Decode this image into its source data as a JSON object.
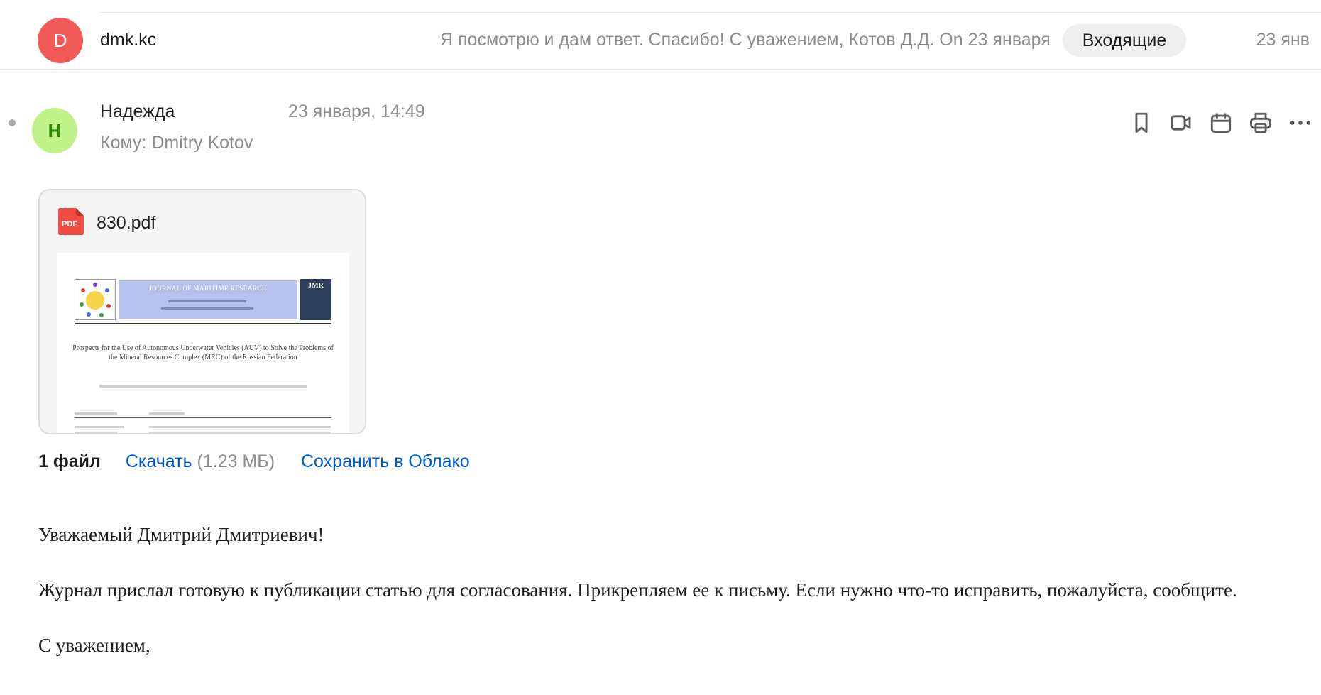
{
  "thread": {
    "avatar_letter": "D",
    "sender": "dmk.kotov",
    "snippet": "Я посмотрю и дам ответ. Спасибо! С уважением, Котов Д.Д. On 23 января",
    "folder": "Входящие",
    "date": "23 янв",
    "colors": {
      "avatar_bg": "#f25a58"
    }
  },
  "message": {
    "avatar_letter": "Н",
    "from": "Надежда",
    "date": "23 января, 14:49",
    "to": "Кому: Dmitry Kotov",
    "colors": {
      "avatar_bg": "#bff28b",
      "avatar_fg": "#2e8b00"
    },
    "toolbar": [
      {
        "name": "bookmark-icon"
      },
      {
        "name": "video-call-icon"
      },
      {
        "name": "calendar-icon"
      },
      {
        "name": "print-icon"
      },
      {
        "name": "more-icon"
      }
    ]
  },
  "attachment": {
    "file_type": "PDF",
    "file_name": "830.pdf",
    "preview": {
      "journal_title": "JOURNAL OF MARITIME RESEARCH",
      "journal_abbr": "JMR",
      "article_title": "Prospects for the Use of Autonomous Underwater Vehicles (AUV) to Solve the Problems of the Mineral Resources Complex (MRC) of the Russian Federation"
    },
    "count_label": "1 файл",
    "download_label": "Скачать",
    "size": "(1.23 МБ)",
    "save_cloud_label": "Сохранить в Облако"
  },
  "body": {
    "greeting": "Уважаемый Дмитрий Дмитриевич!",
    "paragraph": "Журнал прислал готовую к публикации статью для согласования. Прикрепляем ее к письму. Если нужно что-то исправить, пожалуйста, сообщите.",
    "closing": "С уважением,"
  },
  "colors": {
    "link": "#005bd1",
    "muted": "#8c8c8c"
  }
}
